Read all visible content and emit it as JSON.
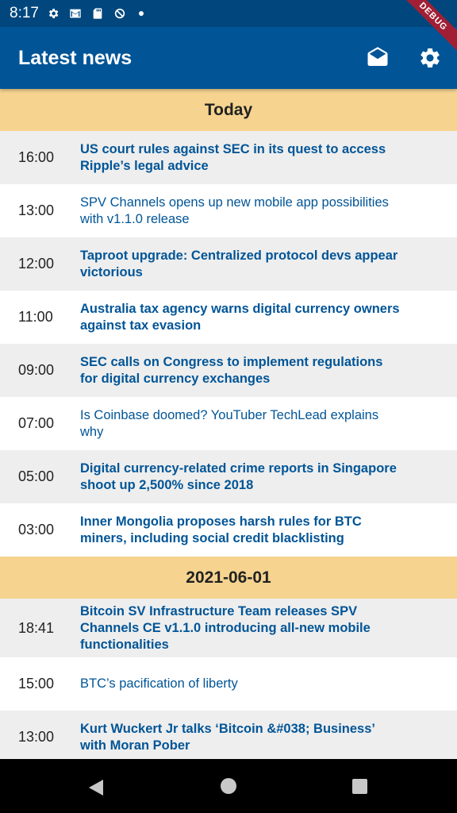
{
  "status_bar": {
    "time": "8:17"
  },
  "app_bar": {
    "title": "Latest news",
    "debug_label": "DEBUG"
  },
  "sections": [
    {
      "header": "Today",
      "items": [
        {
          "time": "16:00",
          "title": "US court rules against SEC in its quest to access Ripple’s legal advice",
          "bold": true
        },
        {
          "time": "13:00",
          "title": "SPV Channels opens up new mobile app possibilities with v1.1.0 release",
          "bold": false
        },
        {
          "time": "12:00",
          "title": "Taproot upgrade: Centralized protocol devs appear victorious",
          "bold": true
        },
        {
          "time": "11:00",
          "title": "Australia tax agency warns digital currency owners against tax evasion",
          "bold": true
        },
        {
          "time": "09:00",
          "title": "SEC calls on Congress to implement regulations for digital currency exchanges",
          "bold": true
        },
        {
          "time": "07:00",
          "title": "Is Coinbase doomed? YouTuber TechLead explains why",
          "bold": false
        },
        {
          "time": "05:00",
          "title": "Digital currency-related crime reports in Singapore shoot up 2,500% since 2018",
          "bold": true
        },
        {
          "time": "03:00",
          "title": "Inner Mongolia proposes harsh rules for BTC miners, including social credit blacklisting",
          "bold": true
        }
      ]
    },
    {
      "header": "2021-06-01",
      "items": [
        {
          "time": "18:41",
          "title": "Bitcoin SV Infrastructure Team releases SPV Channels CE v1.1.0 introducing all-new mobile functionalities",
          "bold": true
        },
        {
          "time": "15:00",
          "title": "BTC’s pacification of liberty",
          "bold": false
        },
        {
          "time": "13:00",
          "title": "Kurt Wuckert Jr talks ‘Bitcoin &#038; Business’ with Moran Pober",
          "bold": true
        }
      ]
    }
  ]
}
